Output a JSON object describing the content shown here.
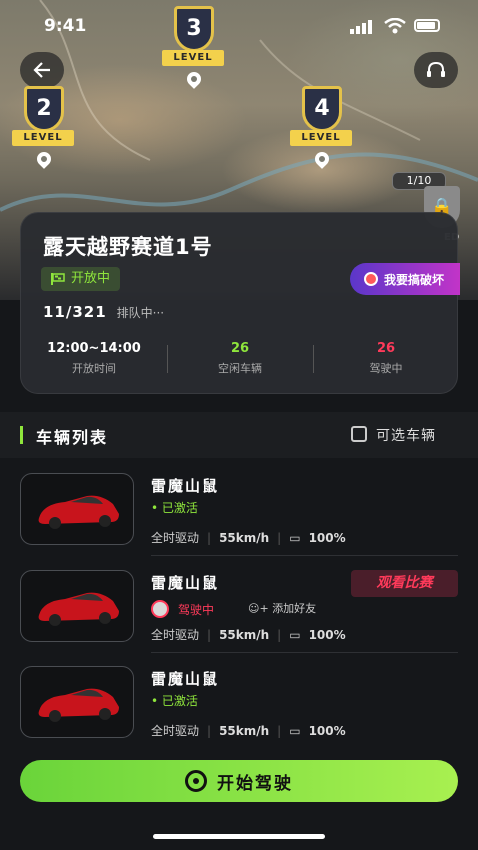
{
  "status_bar": {
    "time": "9:41"
  },
  "map": {
    "levels": [
      {
        "number": "3",
        "label": "LEVEL"
      },
      {
        "number": "2",
        "label": "LEVEL"
      },
      {
        "number": "4",
        "label": "LEVEL"
      }
    ],
    "progress": "1/10",
    "locked_label": "ED"
  },
  "card": {
    "title": "露天越野赛道1号",
    "open_status": "开放中",
    "report_button": "我要搞破坏",
    "queue_number": "11/321",
    "queue_status": "排队中···",
    "stats": [
      {
        "value": "12:00~14:00",
        "label": "开放时间",
        "color": "#ffffff"
      },
      {
        "value": "26",
        "label": "空闲车辆",
        "color": "#8fe63c"
      },
      {
        "value": "26",
        "label": "驾驶中",
        "color": "#ff3a5a"
      }
    ]
  },
  "vehicle_list": {
    "title": "车辆列表",
    "filter_label": "可选车辆",
    "items": [
      {
        "name": "雷魔山鼠",
        "status": "已激活",
        "drive": "全时驱动",
        "speed": "55km/h",
        "battery": "100%"
      },
      {
        "name": "雷魔山鼠",
        "status": "驾驶中",
        "watch": "观看比赛",
        "add_friend": "添加好友",
        "drive": "全时驱动",
        "speed": "55km/h",
        "battery": "100%"
      },
      {
        "name": "雷魔山鼠",
        "status": "已激活",
        "drive": "全时驱动",
        "speed": "55km/h",
        "battery": "100%"
      }
    ]
  },
  "start_button": "开始驾驶",
  "colors": {
    "accent": "#8fe63c",
    "danger": "#ff3a5a",
    "background": "#15171a"
  }
}
